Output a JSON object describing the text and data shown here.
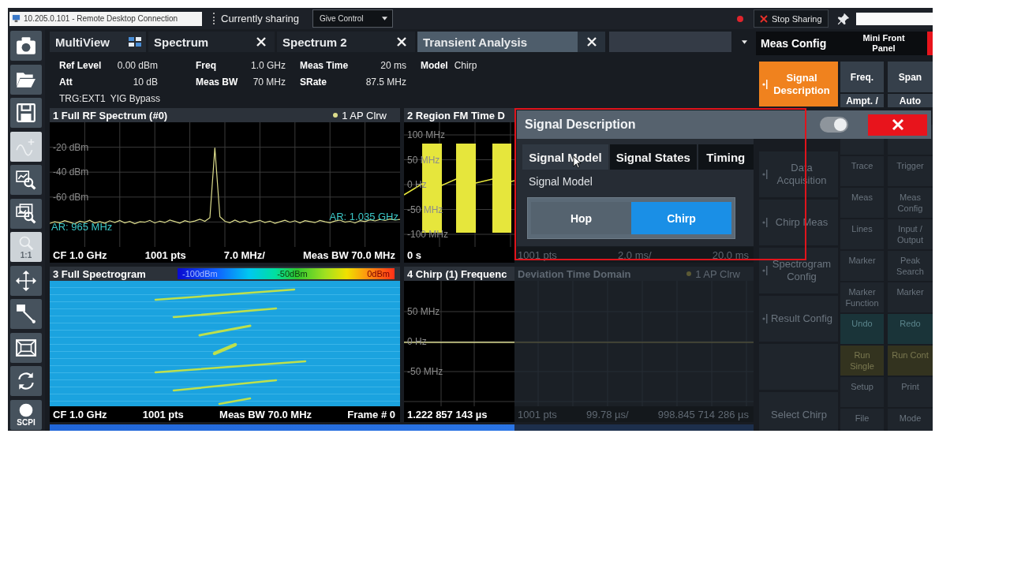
{
  "remote_session": {
    "title": "10.205.0.101 - Remote Desktop Connection",
    "status": "Currently sharing",
    "control_menu": "Give Control",
    "stop_button": "Stop Sharing"
  },
  "toolbar": [
    {
      "kind": "camera",
      "disabled": false
    },
    {
      "kind": "open",
      "disabled": false
    },
    {
      "kind": "save",
      "disabled": false
    },
    {
      "kind": "add-trace",
      "disabled": true
    },
    {
      "kind": "zoom",
      "disabled": false
    },
    {
      "kind": "multi-zoom",
      "disabled": false
    },
    {
      "kind": "zoom-reset",
      "disabled": true,
      "label": "1:1"
    },
    {
      "kind": "move",
      "disabled": false
    },
    {
      "kind": "resize",
      "disabled": false
    },
    {
      "kind": "fullscreen",
      "disabled": false
    },
    {
      "kind": "refresh",
      "disabled": false
    },
    {
      "kind": "scpi",
      "disabled": false,
      "label": "SCPI"
    }
  ],
  "tabs": [
    {
      "label": "MultiView",
      "kind": "overview",
      "selected": false
    },
    {
      "label": "Spectrum",
      "kind": "channel",
      "selected": false
    },
    {
      "label": "Spectrum 2",
      "kind": "channel",
      "selected": false
    },
    {
      "label": "Transient Analysis",
      "kind": "channel",
      "selected": true
    }
  ],
  "info_bar": {
    "rows": [
      [
        {
          "label": "Ref Level",
          "value": "0.00 dBm"
        },
        {
          "label": "Freq",
          "value": "1.0 GHz"
        },
        {
          "label": "Meas Time",
          "value": "20 ms"
        },
        {
          "label": "Model",
          "value": "Chirp"
        }
      ],
      [
        {
          "label": "Att",
          "value": "10 dB"
        },
        {
          "label": "Meas BW",
          "value": "70 MHz"
        },
        {
          "label": "SRate",
          "value": "87.5 MHz"
        }
      ]
    ],
    "trigger": [
      "TRG:EXT1",
      "YIG Bypass"
    ]
  },
  "windows": [
    {
      "kind": "spectrum",
      "title": "1 Full RF Spectrum (#0)",
      "markers": [
        "AR: 965 MHz",
        "AR: 1.035 GHz"
      ],
      "footer": [
        "CF 1.0 GHz",
        "1001 pts",
        "7.0 MHz/",
        "Meas BW 70.0 MHz"
      ],
      "chart_data": {
        "type": "line",
        "grid": true,
        "categories": [
          null,
          null,
          null,
          null,
          null,
          null,
          null,
          null,
          null,
          null,
          null,
          null,
          null,
          null,
          null,
          null,
          null,
          null,
          null,
          null,
          null,
          null,
          null,
          null,
          null,
          null,
          null,
          null,
          null,
          null,
          null,
          null,
          null,
          null,
          null,
          null,
          null,
          null,
          null,
          null,
          null,
          null,
          null,
          null,
          null,
          null,
          null,
          null,
          null,
          null,
          null,
          null,
          null,
          null,
          null,
          null,
          null,
          null,
          null,
          null,
          null,
          null,
          null,
          null,
          null,
          null,
          null,
          null,
          null,
          null,
          null
        ],
        "ylim": [
          -100,
          0
        ],
        "yticks": [
          {
            "value": -20,
            "label": "-20 dBm"
          },
          {
            "value": -40,
            "label": "-40 dBm"
          },
          {
            "value": -60,
            "label": "-60 dBm"
          }
        ],
        "series": [
          {
            "name": "1 AP Clrw",
            "color": "#dcdc8c",
            "values": [
              -81.2,
              -79.8,
              -80.6,
              -78.9,
              -80.1,
              -81.5,
              -79.4,
              -80.3,
              -78.6,
              -80.9,
              -79.7,
              -81.1,
              -79.0,
              -80.4,
              -78.8,
              -80.7,
              -79.5,
              -81.3,
              -79.9,
              -80.2,
              -78.7,
              -80.8,
              -79.3,
              -80.5,
              -78.4,
              -79.6,
              -80.9,
              -78.9,
              -80.1,
              -79.2,
              -77.8,
              -79.5,
              -76.5,
              -20.5,
              -75.8,
              -79.4,
              -80.6,
              -78.5,
              -80.3,
              -79.1,
              -80.8,
              -79.6,
              -78.7,
              -80.4,
              -79.3,
              -81.0,
              -79.8,
              -78.6,
              -80.2,
              -79.0,
              -80.7,
              -78.9,
              -79.7,
              -80.5,
              -78.8,
              -79.9,
              -80.6,
              -79.2,
              -78.5,
              -80.1,
              -79.4,
              -80.8,
              -78.9,
              -79.6,
              -78.2,
              -79.1,
              -77.9,
              -78.8,
              -77.6,
              -78.4,
              -77.9
            ]
          }
        ]
      }
    },
    {
      "kind": "region-fm",
      "title": "2 Region FM Time D",
      "y_labels": [
        "100 MHz",
        "50 MHz",
        "0 Hz",
        "-50 MHz",
        "-100 MHz"
      ],
      "footer": [
        "0 s"
      ],
      "dimmed_footer": [
        "1001 pts",
        "2.0 ms/",
        "20.0 ms"
      ]
    },
    {
      "kind": "spectrogram",
      "title": "3 Full Spectrogram",
      "color_scale": [
        "-100dBm",
        "-50dBm",
        "0dBm"
      ],
      "footer": [
        "CF 1.0 GHz",
        "1001 pts",
        "Meas BW 70.0 MHz",
        "Frame # 0"
      ]
    },
    {
      "kind": "chirp-deviation",
      "title": "4 Chirp (1) Frequenc",
      "y_labels": [
        "50 MHz",
        "0 Hz",
        "-50 MHz"
      ],
      "footer": [
        "1.222 857 143 µs"
      ],
      "dimmed_title": "Deviation Time Domain",
      "dimmed_trace_label": "1 AP Clrw",
      "dimmed_footer": [
        "1001 pts",
        "99.78 µs/",
        "998.845 714 286 µs"
      ]
    }
  ],
  "side_panel": {
    "meas_config_title": "Meas Config",
    "mini_panel_title": "Mini Front Panel",
    "meas_config_keys": [
      {
        "label": "Signal Description",
        "selected": true,
        "dimmed": false,
        "submenu": true
      },
      {
        "label": "Data Acquisition",
        "selected": false,
        "dimmed": true,
        "submenu": true
      },
      {
        "label": "Chirp Meas",
        "selected": false,
        "dimmed": true,
        "submenu": true
      },
      {
        "label": "Spectrogram Config",
        "selected": false,
        "dimmed": true,
        "submenu": true
      },
      {
        "label": "Result Config",
        "selected": false,
        "dimmed": true,
        "submenu": true
      },
      {
        "selected": false,
        "dimmed": true,
        "submenu": false
      },
      {
        "label": "Select Chirp",
        "selected": false,
        "dimmed": true,
        "submenu": false
      }
    ],
    "front_panel_keys": [
      {
        "label": "Freq.",
        "kind": "normal",
        "dimmed": false
      },
      {
        "label": "Span",
        "kind": "normal",
        "dimmed": false
      },
      {
        "label": "Ampt. /",
        "kind": "normal",
        "dimmed": false
      },
      {
        "label": "Auto",
        "kind": "normal",
        "dimmed": false
      },
      {
        "kind": "normal",
        "dimmed": true
      },
      {
        "kind": "normal",
        "dimmed": true
      },
      {
        "label": "Trace",
        "kind": "normal",
        "dimmed": true
      },
      {
        "label": "Trigger",
        "kind": "normal",
        "dimmed": true
      },
      {
        "label": "Meas",
        "kind": "normal",
        "dimmed": true
      },
      {
        "label": "Meas Config",
        "kind": "normal",
        "dimmed": true
      },
      {
        "label": "Lines",
        "kind": "normal",
        "dimmed": true
      },
      {
        "label": "Input / Output",
        "kind": "normal",
        "dimmed": true
      },
      {
        "label": "Marker",
        "kind": "normal",
        "dimmed": true
      },
      {
        "label": "Peak Search",
        "kind": "normal",
        "dimmed": true
      },
      {
        "label": "Marker Function",
        "kind": "normal",
        "dimmed": true
      },
      {
        "label": "Marker",
        "kind": "normal",
        "dimmed": true
      },
      {
        "label": "Undo",
        "kind": "edit",
        "dimmed": true
      },
      {
        "label": "Redo",
        "kind": "edit",
        "dimmed": true
      },
      {
        "label": "Run Single",
        "kind": "run",
        "dimmed": true
      },
      {
        "label": "Run Cont",
        "kind": "run",
        "dimmed": true
      },
      {
        "label": "Setup",
        "kind": "normal",
        "dimmed": true
      },
      {
        "label": "Print",
        "kind": "normal",
        "dimmed": true
      },
      {
        "label": "File",
        "kind": "normal",
        "dimmed": true
      },
      {
        "label": "Mode",
        "kind": "normal",
        "dimmed": true
      }
    ]
  },
  "dialog": {
    "title": "Signal Description",
    "toggle_on": true,
    "tabs": [
      {
        "label": "Signal Model",
        "selected": true
      },
      {
        "label": "Signal States",
        "selected": false
      },
      {
        "label": "Timing",
        "selected": false
      }
    ],
    "field_label": "Signal Model",
    "options": [
      {
        "label": "Hop",
        "selected": false
      },
      {
        "label": "Chirp",
        "selected": true
      }
    ]
  }
}
